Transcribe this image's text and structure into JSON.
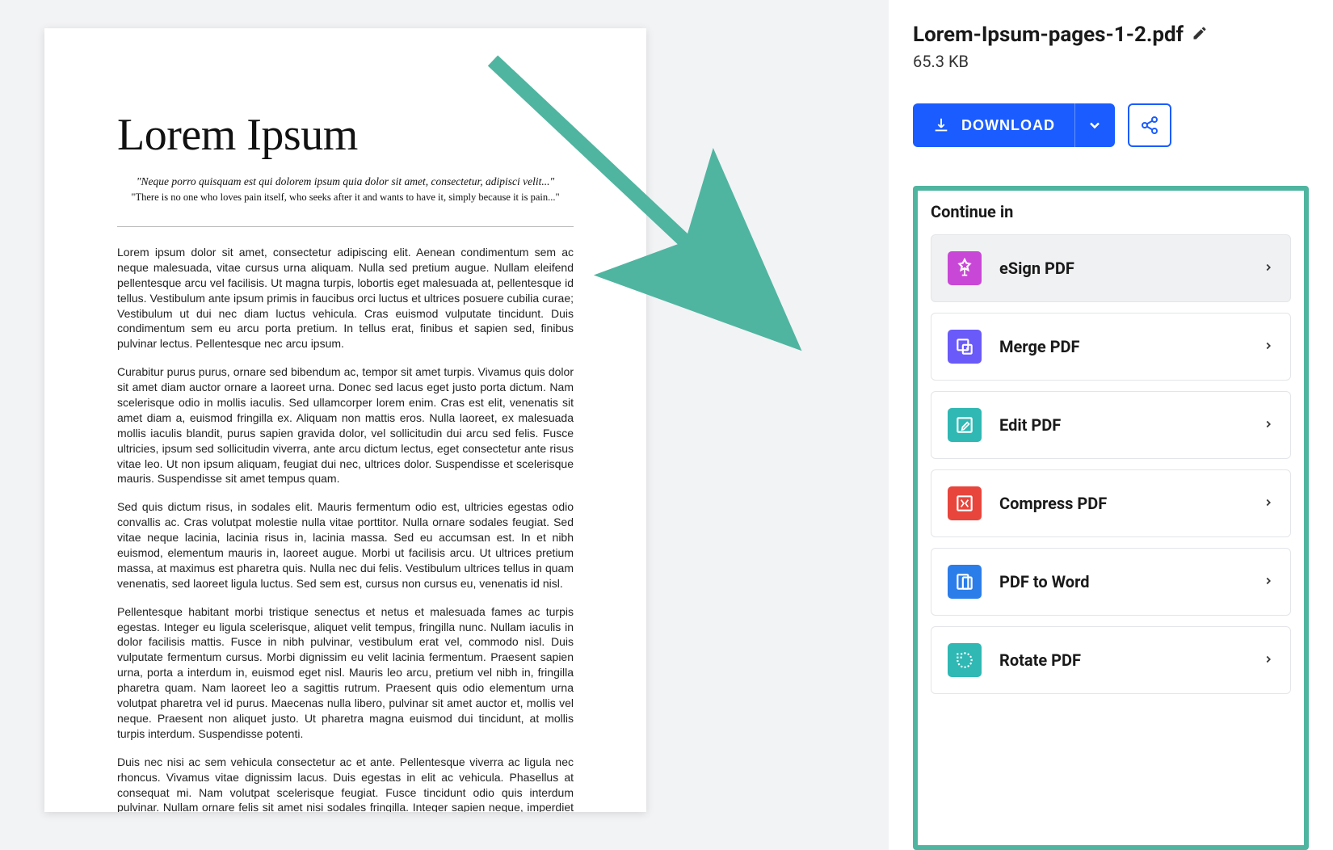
{
  "document": {
    "title": "Lorem Ipsum",
    "subtitle1": "\"Neque porro quisquam est qui dolorem ipsum quia dolor sit amet, consectetur, adipisci velit...\"",
    "subtitle2": "\"There is no one who loves pain itself, who seeks after it and wants to have it, simply because it is pain...\"",
    "paragraphs": [
      "Lorem ipsum dolor sit amet, consectetur adipiscing elit. Aenean condimentum sem ac neque malesuada, vitae cursus urna aliquam. Nulla sed pretium augue. Nullam eleifend pellentesque arcu vel facilisis. Ut magna turpis, lobortis eget malesuada at, pellentesque id tellus. Vestibulum ante ipsum primis in faucibus orci luctus et ultrices posuere cubilia curae; Vestibulum ut dui nec diam luctus vehicula. Cras euismod vulputate tincidunt. Duis condimentum sem eu arcu porta pretium. In tellus erat, finibus et sapien sed, finibus pulvinar lectus. Pellentesque nec arcu ipsum.",
      "Curabitur purus purus, ornare sed bibendum ac, tempor sit amet turpis. Vivamus quis dolor sit amet diam auctor ornare a laoreet urna. Donec sed lacus eget justo porta dictum. Nam scelerisque odio in mollis iaculis. Sed ullamcorper lorem enim. Cras est elit, venenatis sit amet diam a, euismod fringilla ex. Aliquam non mattis eros. Nulla laoreet, ex malesuada mollis iaculis blandit, purus sapien gravida dolor, vel sollicitudin dui arcu sed felis. Fusce ultricies, ipsum sed sollicitudin viverra, ante arcu dictum lectus, eget consectetur ante risus vitae leo. Ut non ipsum aliquam, feugiat dui nec, ultrices dolor. Suspendisse et scelerisque mauris. Suspendisse sit amet tempus quam.",
      "Sed quis dictum risus, in sodales elit. Mauris fermentum odio est, ultricies egestas odio convallis ac. Cras volutpat molestie nulla vitae porttitor. Nulla ornare sodales feugiat. Sed vitae neque lacinia, lacinia risus in, lacinia massa. Sed eu accumsan est. In et nibh euismod, elementum mauris in, laoreet augue. Morbi ut facilisis arcu. Ut ultrices pretium massa, at maximus est pharetra quis. Nulla nec dui felis. Vestibulum ultrices tellus in quam venenatis, sed laoreet ligula luctus. Sed sem est, cursus non cursus eu, venenatis id nisl.",
      "Pellentesque habitant morbi tristique senectus et netus et malesuada fames ac turpis egestas. Integer eu ligula scelerisque, aliquet velit tempus, fringilla nunc. Nullam iaculis in dolor facilisis mattis. Fusce in nibh pulvinar, vestibulum erat vel, commodo nisl. Duis vulputate fermentum cursus. Morbi dignissim eu velit lacinia fermentum. Praesent sapien urna, porta a interdum in, euismod eget nisl. Mauris leo arcu, pretium vel nibh in, fringilla pharetra quam. Nam laoreet leo a sagittis rutrum. Praesent quis odio elementum urna volutpat pharetra vel id purus. Maecenas nulla libero, pulvinar sit amet auctor et, mollis vel neque. Praesent non aliquet justo. Ut pharetra magna euismod dui tincidunt, at mollis turpis interdum. Suspendisse potenti.",
      "Duis nec nisi ac sem vehicula consectetur ac et ante. Pellentesque viverra ac ligula nec rhoncus. Vivamus vitae dignissim lacus. Duis egestas in elit ac vehicula. Phasellus at consequat mi. Nam volutpat scelerisque feugiat. Fusce tincidunt odio quis interdum pulvinar. Nullam ornare felis sit amet nisi sodales fringilla. Integer sapien neque, imperdiet vel ligula in, consectetur semper mi. Nunc sit amet neque tempus aliquet ac sed augue. Cras ut sapien ex."
    ]
  },
  "file": {
    "name": "Lorem-Ipsum-pages-1-2.pdf",
    "size": "65.3 KB"
  },
  "actions": {
    "download_label": "DOWNLOAD"
  },
  "continue": {
    "title": "Continue in",
    "tools": [
      {
        "label": "eSign PDF",
        "icon": "esign",
        "highlighted": true
      },
      {
        "label": "Merge PDF",
        "icon": "merge",
        "highlighted": false
      },
      {
        "label": "Edit PDF",
        "icon": "edit",
        "highlighted": false
      },
      {
        "label": "Compress PDF",
        "icon": "compress",
        "highlighted": false
      },
      {
        "label": "PDF to Word",
        "icon": "word",
        "highlighted": false
      },
      {
        "label": "Rotate PDF",
        "icon": "rotate",
        "highlighted": false
      }
    ]
  },
  "colors": {
    "primary": "#1a5cff",
    "accent_teal": "#4fb5a0"
  }
}
